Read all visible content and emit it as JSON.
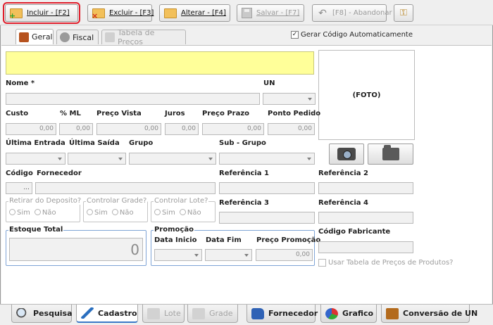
{
  "toolbar": {
    "incluir": "Incluir - [F2]",
    "excluir": "Excluir - [F3]",
    "alterar": "Alterar - [F4]",
    "salvar": "Salvar - [F7]",
    "abandonar": "[F8] - Abandonar"
  },
  "tabs": {
    "geral": "Geral",
    "fiscal": "Fiscal",
    "tabela": "Tabela de Preços"
  },
  "gerar_codigo": "Gerar Código Automaticamente",
  "form": {
    "nome": "Nome *",
    "un": "UN",
    "foto": "(FOTO)",
    "custo": "Custo",
    "ml": "% ML",
    "preco_vista": "Preço Vista",
    "juros": "Juros",
    "preco_prazo": "Preço Prazo",
    "ponto_pedido": "Ponto Pedido",
    "zero": "0,00",
    "ultima_entrada": "Última Entrada",
    "ultima_saida": "Última Saída",
    "grupo": "Grupo",
    "sub_grupo": "Sub - Grupo",
    "codigo": "Código",
    "fornecedor": "Fornecedor",
    "codigo_btn": "...",
    "ref1": "Referência 1",
    "ref2": "Referência 2",
    "ref3": "Referência 3",
    "ref4": "Referência 4",
    "retirar": "Retirar do Deposito?",
    "controlar_grade": "Controlar Grade?",
    "controlar_lote": "Controlar Lote?",
    "sim": "Sim",
    "nao": "Não",
    "estoque": "Estoque Total",
    "estoque_val": "0",
    "promocao": "Promoção",
    "data_inicio": "Data Inicio",
    "data_fim": "Data Fim",
    "preco_promocao": "Preço Promoção",
    "codigo_fabricante": "Código Fabricante",
    "usar_tabela": "Usar Tabela de Preços de Produtos?"
  },
  "bottom_tabs": {
    "pesquisa": "Pesquisa",
    "cadastro": "Cadastro",
    "lote": "Lote",
    "grade": "Grade",
    "fornecedor": "Fornecedor",
    "grafico": "Grafico",
    "conversao": "Conversão de UN"
  },
  "colors": {
    "highlight_field": "#ffff99",
    "selected_outline": "#e01e2b",
    "group_border": "#7fa4d6"
  }
}
